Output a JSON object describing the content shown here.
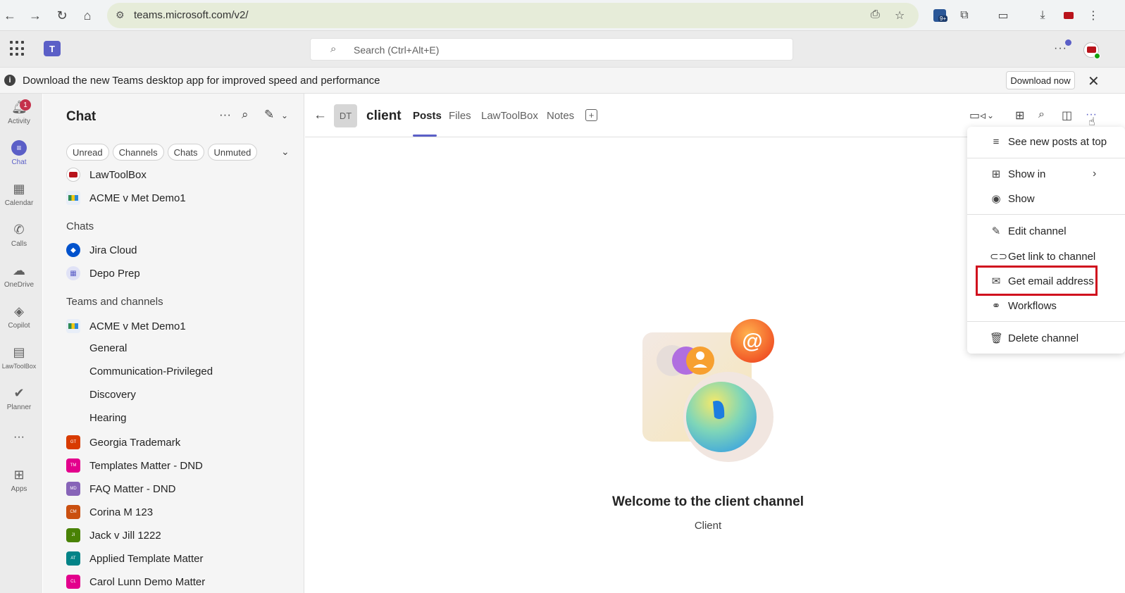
{
  "browser": {
    "url": "teams.microsoft.com/v2/",
    "ext_badge": "9+"
  },
  "top": {
    "search_placeholder": "Search (Ctrl+Alt+E)",
    "more": "···"
  },
  "banner": {
    "message": "Download the new Teams desktop app for improved speed and performance",
    "download_label": "Download now",
    "close": "✕"
  },
  "rail": {
    "activity_badge": "1",
    "items": [
      {
        "label": "Activity",
        "icon": "bell-icon"
      },
      {
        "label": "Chat",
        "icon": "chat-icon"
      },
      {
        "label": "Calendar",
        "icon": "calendar-icon"
      },
      {
        "label": "Calls",
        "icon": "phone-icon"
      },
      {
        "label": "OneDrive",
        "icon": "cloud-icon"
      },
      {
        "label": "Copilot",
        "icon": "copilot-icon"
      },
      {
        "label": "LawToolBox",
        "icon": "lawtoolbox-icon"
      },
      {
        "label": "Planner",
        "icon": "planner-icon"
      },
      {
        "label": "···",
        "icon": "more-icon"
      },
      {
        "label": "Apps",
        "icon": "apps-icon"
      }
    ]
  },
  "chatpane": {
    "title": "Chat",
    "filters": [
      "Unread",
      "Channels",
      "Chats",
      "Unmuted"
    ],
    "favorites": [
      "LawToolBox",
      "ACME v Met Demo1"
    ],
    "chats_header": "Chats",
    "chats": [
      "Jira Cloud",
      "Depo Prep"
    ],
    "teams_header": "Teams and channels",
    "team": "ACME v Met Demo1",
    "channels": [
      "General",
      "Communication-Privileged",
      "Discovery",
      "Hearing"
    ],
    "other_teams": [
      {
        "name": "Georgia Trademark",
        "initials": "GT",
        "color": "#d83b01"
      },
      {
        "name": "Templates Matter - DND",
        "initials": "TM",
        "color": "#e3008c"
      },
      {
        "name": "FAQ Matter - DND",
        "initials": "MD",
        "color": "#8764b8"
      },
      {
        "name": "Corina M 123",
        "initials": "CM",
        "color": "#ca5010"
      },
      {
        "name": "Jack v Jill 1222",
        "initials": "JI",
        "color": "#498205"
      },
      {
        "name": "Applied Template Matter",
        "initials": "AT",
        "color": "#038387"
      },
      {
        "name": "Carol Lunn Demo Matter",
        "initials": "CL",
        "color": "#e3008c"
      }
    ]
  },
  "channel": {
    "initials": "DT",
    "name": "client",
    "tabs": [
      "Posts",
      "Files",
      "LawToolBox",
      "Notes"
    ],
    "active_tab": "Posts"
  },
  "welcome": {
    "title": "Welcome to the client channel",
    "subtitle": "Client"
  },
  "menu": {
    "items": [
      {
        "label": "See new posts at top",
        "icon": "sort-icon"
      },
      {
        "label": "Show in",
        "icon": "add-square-icon",
        "submenu": true
      },
      {
        "label": "Show",
        "icon": "eye-icon"
      },
      {
        "label": "Edit channel",
        "icon": "pencil-icon"
      },
      {
        "label": "Get link to channel",
        "icon": "link-icon"
      },
      {
        "label": "Get email address",
        "icon": "mail-icon",
        "highlighted": true
      },
      {
        "label": "Workflows",
        "icon": "workflow-icon"
      },
      {
        "label": "Delete channel",
        "icon": "trash-icon"
      }
    ]
  },
  "colors": {
    "accent": "#5b5fc7",
    "highlight": "#d0101e"
  }
}
